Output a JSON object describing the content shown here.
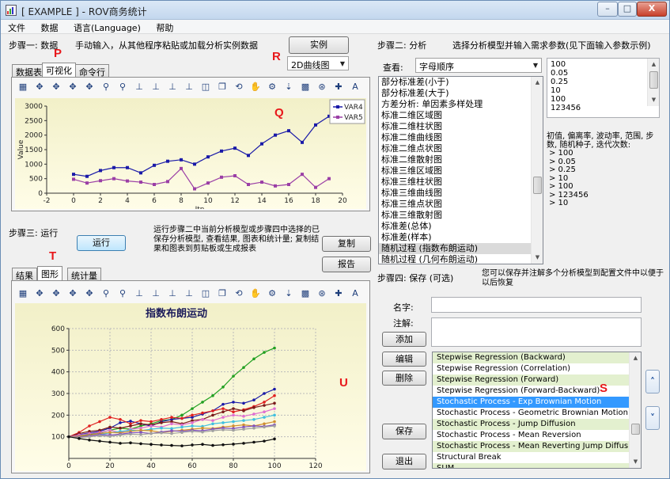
{
  "window": {
    "title": "[ EXAMPLE ] - ROV商务统计",
    "controls": {
      "minimize": "–",
      "maximize": "□",
      "close": "X"
    }
  },
  "menu": [
    "文件",
    "数据",
    "语言(Language)",
    "帮助"
  ],
  "step1": {
    "label": "步骤一: 数据",
    "description": "手动输入，从其他程序粘贴或加载分析实例数据",
    "example_button": "实例",
    "chart_type_select": "2D曲线图",
    "tabs": [
      "数据表",
      "可视化",
      "命令行"
    ],
    "active_tab": "可视化"
  },
  "markers": {
    "P": "P",
    "Q": "Q",
    "R": "R",
    "S": "S",
    "T": "T",
    "U": "U"
  },
  "step2": {
    "label": "步骤二: 分析",
    "description": "选择分析模型并输入需求参数(见下面输入参数示例)",
    "view_label": "查看:",
    "view_select": "字母顺序",
    "methods": [
      "部分标准差(小于)",
      "部分标准差(大于)",
      "方差分析: 单因素多样处理",
      "标准二维区域图",
      "标准二维柱状图",
      "标准二维曲线图",
      "标准二维点状图",
      "标准二维散射图",
      "标准三维区域图",
      "标准三维柱状图",
      "标准三维曲线图",
      "标准三维点状图",
      "标准三维散射图",
      "标准差(总体)",
      "标准差(样本)",
      "随机过程 (指数布朗运动)",
      "随机过程 (几何布朗运动)"
    ],
    "selected_method_index": 15,
    "params": [
      "100",
      "0.05",
      "0.25",
      "10",
      "100",
      "123456"
    ],
    "param_hint": "初值, 偏离率, 波动率, 范围, 步数, 随机种子, 迭代次数:",
    "param_list": [
      ">  100",
      ">  0.05",
      ">  0.25",
      ">  10",
      ">  100",
      ">  123456",
      ">  10"
    ]
  },
  "step3": {
    "label": "步骤三: 运行",
    "run_button": "运行",
    "description": "运行步骤二中当前分析模型或步骤四中选择的已保存分析模型, 查看结果, 图表和统计量; 复制结果和图表到剪贴板或生成报表",
    "copy_button": "复制",
    "report_button": "报告",
    "tabs": [
      "结果",
      "图形",
      "统计量"
    ],
    "active_tab": "图形"
  },
  "step4": {
    "label": "步骤四: 保存 (可选)",
    "description": "您可以保存并注解多个分析模型到配置文件中以便于以后恢复",
    "name_label": "名字:",
    "note_label": "注解:",
    "add_button": "添加",
    "edit_button": "编辑",
    "delete_button": "删除",
    "save_button": "保存",
    "exit_button": "退出",
    "models": [
      "Stepwise Regression (Backward)",
      "Stepwise Regression (Correlation)",
      "Stepwise Regression (Forward)",
      "Stepwise Regression (Forward-Backward)",
      "Stochastic Process - Exp Brownian Motion",
      "Stochastic Process - Geometric Brownian Motion",
      "Stochastic Process - Jump Diffusion",
      "Stochastic Process - Mean Reversion",
      "Stochastic Process - Mean Reverting Jump Diffusion",
      "Structural Break",
      "SUM"
    ],
    "selected_model_index": 4,
    "up_arrow": "˄",
    "down_arrow": "˅"
  },
  "chart_data": [
    {
      "type": "line",
      "title": "",
      "xlabel": "Itn.",
      "ylabel": "Value",
      "xlim": [
        -2,
        20
      ],
      "ylim": [
        0,
        3000
      ],
      "xticks": [
        -2,
        0,
        2,
        4,
        6,
        8,
        10,
        12,
        14,
        16,
        18,
        20
      ],
      "yticks": [
        0,
        500,
        1000,
        1500,
        2000,
        2500,
        3000
      ],
      "legend_position": "top-right",
      "x": [
        0,
        1,
        2,
        3,
        4,
        5,
        6,
        7,
        8,
        9,
        10,
        11,
        12,
        13,
        14,
        15,
        16,
        17,
        18,
        19
      ],
      "series": [
        {
          "name": "VAR4",
          "color": "#1a1aa8",
          "marker": "square",
          "values": [
            650,
            580,
            780,
            880,
            880,
            700,
            960,
            1100,
            1150,
            1000,
            1250,
            1450,
            1550,
            1300,
            1700,
            2000,
            2150,
            1750,
            2350,
            2650
          ]
        },
        {
          "name": "VAR5",
          "color": "#9b3fa6",
          "marker": "square",
          "values": [
            480,
            350,
            430,
            500,
            420,
            380,
            300,
            400,
            850,
            150,
            350,
            550,
            600,
            300,
            380,
            250,
            300,
            650,
            200,
            500
          ]
        }
      ]
    },
    {
      "type": "line",
      "title": "指数布朗运动",
      "xlabel": "",
      "ylabel": "",
      "xlim": [
        0,
        120
      ],
      "ylim": [
        0,
        600
      ],
      "xticks": [
        0,
        20,
        40,
        60,
        80,
        100,
        120
      ],
      "yticks": [
        100,
        200,
        300,
        400,
        500,
        600
      ],
      "grid": true,
      "series": [
        {
          "color": "#22a022",
          "values": [
            100,
            105,
            112,
            118,
            130,
            140,
            135,
            150,
            160,
            175,
            180,
            200,
            230,
            260,
            290,
            330,
            380,
            420,
            460,
            490,
            510
          ]
        },
        {
          "color": "#1a1aa8",
          "values": [
            100,
            110,
            118,
            125,
            140,
            165,
            172,
            160,
            150,
            170,
            180,
            185,
            190,
            205,
            220,
            250,
            260,
            255,
            270,
            300,
            320
          ]
        },
        {
          "color": "#e02020",
          "values": [
            100,
            120,
            150,
            170,
            190,
            180,
            160,
            175,
            170,
            180,
            190,
            185,
            200,
            210,
            220,
            230,
            215,
            225,
            240,
            260,
            290
          ]
        },
        {
          "color": "#7a1a1a",
          "values": [
            100,
            115,
            125,
            130,
            145,
            140,
            150,
            160,
            155,
            165,
            170,
            160,
            175,
            180,
            200,
            215,
            230,
            220,
            235,
            245,
            255
          ]
        },
        {
          "color": "#e070d0",
          "values": [
            100,
            108,
            115,
            120,
            130,
            120,
            135,
            140,
            150,
            145,
            160,
            155,
            165,
            180,
            175,
            190,
            200,
            195,
            205,
            215,
            230
          ]
        },
        {
          "color": "#40c0e0",
          "values": [
            100,
            95,
            105,
            110,
            118,
            125,
            130,
            128,
            135,
            140,
            138,
            145,
            150,
            148,
            160,
            165,
            170,
            175,
            180,
            190,
            200
          ]
        },
        {
          "color": "#d09030",
          "values": [
            100,
            102,
            108,
            115,
            120,
            118,
            125,
            130,
            128,
            120,
            125,
            130,
            135,
            140,
            138,
            145,
            150,
            155,
            150,
            160,
            170
          ]
        },
        {
          "color": "#8050c0",
          "values": [
            100,
            98,
            104,
            110,
            108,
            112,
            118,
            120,
            115,
            122,
            128,
            125,
            130,
            128,
            135,
            140,
            138,
            145,
            150,
            148,
            155
          ]
        },
        {
          "color": "#a0a0a0",
          "values": [
            100,
            96,
            100,
            105,
            102,
            108,
            112,
            110,
            115,
            118,
            115,
            120,
            125,
            122,
            128,
            132,
            130,
            135,
            140,
            145,
            150
          ]
        },
        {
          "color": "#111111",
          "values": [
            100,
            92,
            85,
            80,
            75,
            70,
            72,
            68,
            65,
            62,
            60,
            58,
            62,
            65,
            60,
            63,
            66,
            70,
            75,
            80,
            90
          ]
        }
      ],
      "x": [
        0,
        5,
        10,
        15,
        20,
        25,
        30,
        35,
        40,
        45,
        50,
        55,
        60,
        65,
        70,
        75,
        80,
        85,
        90,
        95,
        100
      ]
    }
  ]
}
